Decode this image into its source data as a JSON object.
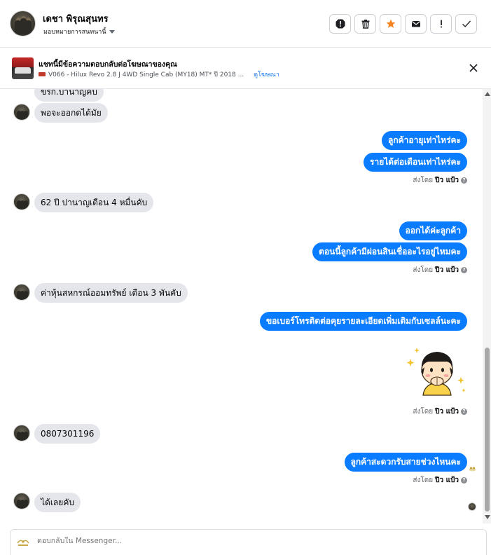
{
  "header": {
    "name": "เดชา พิรุณสุนทร",
    "assign_label": "มอบหมายการสนทนานี้",
    "actions": [
      "spam-icon",
      "trash-icon",
      "star-icon",
      "mail-icon",
      "alert-icon",
      "check-icon"
    ],
    "star_color": "#f5821f"
  },
  "ad": {
    "title": "แชทนี้มีข้อความตอบกลับต่อโฆษณาของคุณ",
    "subtitle": "V066 - Hilux Revo 2.8 J 4WD Single Cab (MY18) MT* ปี 2018 ...",
    "link": "ดูโฆษณา"
  },
  "messages": {
    "m0": "ขรก.บานาญคบ",
    "m1": "พอจะออกดได้มัย",
    "m2": "ลูกค้าอายุเท่าไหร่คะ",
    "m3": "รายได้ต่อเดือนเท่าไหร่คะ",
    "m4": "62 ปี ปานาญเดือน 4 หมื่นคับ",
    "m5": "ออกได้ค่ะลูกค้า",
    "m6": "ตอนนี้ลูกค้ามีผ่อนสินเชื่ออะไรอยู่ไหมคะ",
    "m7": "ค่าหุ้นสหกรณ์ออมทรัพย์ เดือน 3 พันคับ",
    "m8": "ขอเบอร์โทรติดต่อคุยรายละเอียดเพิ่มเติมกับเซลล์นะคะ",
    "m9": "0807301196",
    "m10": "ลูกค้าสะดวกรับสายช่วงไหนคะ",
    "m11": "ได้เลยคับ"
  },
  "sent_by": {
    "prefix": "ส่งโดย",
    "agent": "ปิว แป้ว"
  },
  "composer": {
    "placeholder": "ตอบกลับใน Messenger..."
  },
  "colors": {
    "outgoing_bubble": "#0a7cff",
    "incoming_bubble": "#e4e6eb"
  }
}
